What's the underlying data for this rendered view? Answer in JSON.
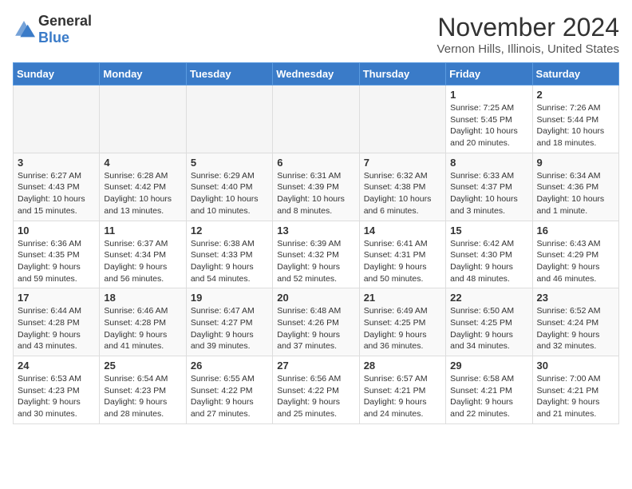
{
  "logo": {
    "general": "General",
    "blue": "Blue"
  },
  "title": "November 2024",
  "location": "Vernon Hills, Illinois, United States",
  "days_of_week": [
    "Sunday",
    "Monday",
    "Tuesday",
    "Wednesday",
    "Thursday",
    "Friday",
    "Saturday"
  ],
  "weeks": [
    [
      {
        "day": "",
        "info": ""
      },
      {
        "day": "",
        "info": ""
      },
      {
        "day": "",
        "info": ""
      },
      {
        "day": "",
        "info": ""
      },
      {
        "day": "",
        "info": ""
      },
      {
        "day": "1",
        "info": "Sunrise: 7:25 AM\nSunset: 5:45 PM\nDaylight: 10 hours and 20 minutes."
      },
      {
        "day": "2",
        "info": "Sunrise: 7:26 AM\nSunset: 5:44 PM\nDaylight: 10 hours and 18 minutes."
      }
    ],
    [
      {
        "day": "3",
        "info": "Sunrise: 6:27 AM\nSunset: 4:43 PM\nDaylight: 10 hours and 15 minutes."
      },
      {
        "day": "4",
        "info": "Sunrise: 6:28 AM\nSunset: 4:42 PM\nDaylight: 10 hours and 13 minutes."
      },
      {
        "day": "5",
        "info": "Sunrise: 6:29 AM\nSunset: 4:40 PM\nDaylight: 10 hours and 10 minutes."
      },
      {
        "day": "6",
        "info": "Sunrise: 6:31 AM\nSunset: 4:39 PM\nDaylight: 10 hours and 8 minutes."
      },
      {
        "day": "7",
        "info": "Sunrise: 6:32 AM\nSunset: 4:38 PM\nDaylight: 10 hours and 6 minutes."
      },
      {
        "day": "8",
        "info": "Sunrise: 6:33 AM\nSunset: 4:37 PM\nDaylight: 10 hours and 3 minutes."
      },
      {
        "day": "9",
        "info": "Sunrise: 6:34 AM\nSunset: 4:36 PM\nDaylight: 10 hours and 1 minute."
      }
    ],
    [
      {
        "day": "10",
        "info": "Sunrise: 6:36 AM\nSunset: 4:35 PM\nDaylight: 9 hours and 59 minutes."
      },
      {
        "day": "11",
        "info": "Sunrise: 6:37 AM\nSunset: 4:34 PM\nDaylight: 9 hours and 56 minutes."
      },
      {
        "day": "12",
        "info": "Sunrise: 6:38 AM\nSunset: 4:33 PM\nDaylight: 9 hours and 54 minutes."
      },
      {
        "day": "13",
        "info": "Sunrise: 6:39 AM\nSunset: 4:32 PM\nDaylight: 9 hours and 52 minutes."
      },
      {
        "day": "14",
        "info": "Sunrise: 6:41 AM\nSunset: 4:31 PM\nDaylight: 9 hours and 50 minutes."
      },
      {
        "day": "15",
        "info": "Sunrise: 6:42 AM\nSunset: 4:30 PM\nDaylight: 9 hours and 48 minutes."
      },
      {
        "day": "16",
        "info": "Sunrise: 6:43 AM\nSunset: 4:29 PM\nDaylight: 9 hours and 46 minutes."
      }
    ],
    [
      {
        "day": "17",
        "info": "Sunrise: 6:44 AM\nSunset: 4:28 PM\nDaylight: 9 hours and 43 minutes."
      },
      {
        "day": "18",
        "info": "Sunrise: 6:46 AM\nSunset: 4:28 PM\nDaylight: 9 hours and 41 minutes."
      },
      {
        "day": "19",
        "info": "Sunrise: 6:47 AM\nSunset: 4:27 PM\nDaylight: 9 hours and 39 minutes."
      },
      {
        "day": "20",
        "info": "Sunrise: 6:48 AM\nSunset: 4:26 PM\nDaylight: 9 hours and 37 minutes."
      },
      {
        "day": "21",
        "info": "Sunrise: 6:49 AM\nSunset: 4:25 PM\nDaylight: 9 hours and 36 minutes."
      },
      {
        "day": "22",
        "info": "Sunrise: 6:50 AM\nSunset: 4:25 PM\nDaylight: 9 hours and 34 minutes."
      },
      {
        "day": "23",
        "info": "Sunrise: 6:52 AM\nSunset: 4:24 PM\nDaylight: 9 hours and 32 minutes."
      }
    ],
    [
      {
        "day": "24",
        "info": "Sunrise: 6:53 AM\nSunset: 4:23 PM\nDaylight: 9 hours and 30 minutes."
      },
      {
        "day": "25",
        "info": "Sunrise: 6:54 AM\nSunset: 4:23 PM\nDaylight: 9 hours and 28 minutes."
      },
      {
        "day": "26",
        "info": "Sunrise: 6:55 AM\nSunset: 4:22 PM\nDaylight: 9 hours and 27 minutes."
      },
      {
        "day": "27",
        "info": "Sunrise: 6:56 AM\nSunset: 4:22 PM\nDaylight: 9 hours and 25 minutes."
      },
      {
        "day": "28",
        "info": "Sunrise: 6:57 AM\nSunset: 4:21 PM\nDaylight: 9 hours and 24 minutes."
      },
      {
        "day": "29",
        "info": "Sunrise: 6:58 AM\nSunset: 4:21 PM\nDaylight: 9 hours and 22 minutes."
      },
      {
        "day": "30",
        "info": "Sunrise: 7:00 AM\nSunset: 4:21 PM\nDaylight: 9 hours and 21 minutes."
      }
    ]
  ]
}
